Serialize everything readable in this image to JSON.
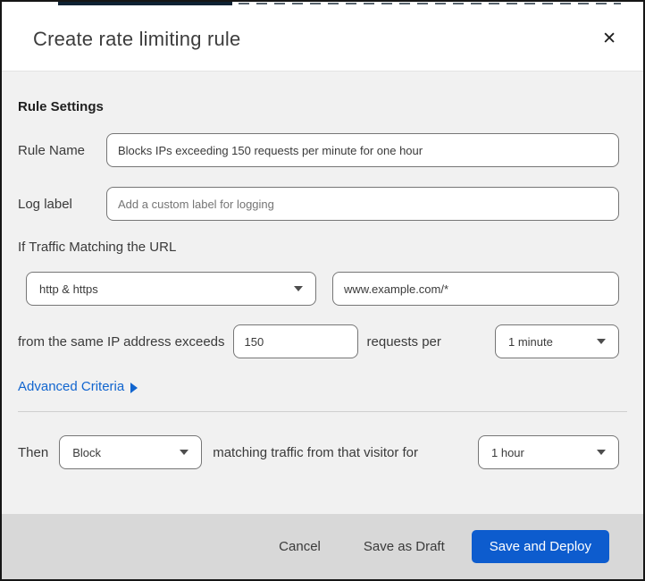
{
  "dialog": {
    "title": "Create rate limiting rule"
  },
  "icons": {
    "close": "✕",
    "dropdown_caret": "▼",
    "advanced_expand": "▶"
  },
  "rule_settings": {
    "heading": "Rule Settings",
    "rule_name": {
      "label": "Rule Name",
      "value": "Blocks IPs exceeding 150 requests per minute for one hour"
    },
    "log_label": {
      "label": "Log label",
      "placeholder": "Add a custom label for logging"
    }
  },
  "match": {
    "intro": "If Traffic Matching the URL",
    "scheme_select": {
      "value": "http & https"
    },
    "url_input": {
      "value": "www.example.com/*"
    },
    "exceeds_text": "from the same IP address exceeds",
    "threshold_input": {
      "value": "150"
    },
    "requests_per_text": "requests per",
    "period_select": {
      "value": "1 minute"
    },
    "advanced_link": "Advanced Criteria"
  },
  "action": {
    "then_text": "Then",
    "action_select": {
      "value": "Block"
    },
    "middle_text": "matching traffic from that visitor for",
    "duration_select": {
      "value": "1 hour"
    }
  },
  "footer": {
    "cancel": "Cancel",
    "save_draft": "Save as Draft",
    "save_deploy": "Save and Deploy"
  },
  "colors": {
    "primary_button": "#0d5cce",
    "link": "#1165cf",
    "header_bg": "#ffffff",
    "body_bg": "#f1f1f1",
    "footer_bg": "#d8d8d8",
    "input_border": "#767676",
    "outer_border": "#161616",
    "top_strip": "#0e2233"
  }
}
